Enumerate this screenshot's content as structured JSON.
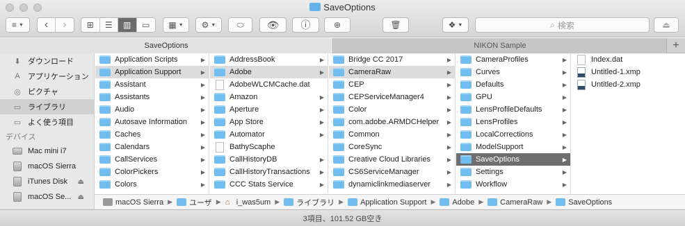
{
  "window": {
    "title": "SaveOptions"
  },
  "toolbar": {
    "search_placeholder": "検索",
    "icons": {
      "sidebar": "≡",
      "back": "‹",
      "forward": "›",
      "view_icon": "⊞",
      "view_list": "☰",
      "view_column": "▥",
      "view_cover": "▭",
      "arrange": "▦",
      "gear": "⚙",
      "tag": "⬭",
      "eye": "👁",
      "info": "ⓘ",
      "new_folder": "⊕",
      "trash": "🗑",
      "dropbox": "❖",
      "search": "⌕",
      "eject": "⏏"
    }
  },
  "tabs": [
    {
      "label": "SaveOptions",
      "active": true
    },
    {
      "label": "NIKON Sample",
      "active": false
    }
  ],
  "tab_add": "+",
  "sidebar": {
    "favorites": [
      {
        "label": "ダウンロード",
        "icon": "⬇",
        "selected": false
      },
      {
        "label": "アプリケーション",
        "icon": "A",
        "selected": false
      },
      {
        "label": "ピクチャ",
        "icon": "◎",
        "selected": false
      },
      {
        "label": "ライブラリ",
        "icon": "▭",
        "selected": true
      },
      {
        "label": "よく使う項目",
        "icon": "▭",
        "selected": false
      }
    ],
    "devices_label": "デバイス",
    "devices": [
      {
        "label": "Mac mini i7",
        "eject": ""
      },
      {
        "label": "macOS Sierra",
        "eject": ""
      },
      {
        "label": "iTunes Disk",
        "eject": "⏏"
      },
      {
        "label": "macOS Se...",
        "eject": "⏏"
      }
    ]
  },
  "columns": [
    [
      "Application Scripts",
      "Application Support",
      "Assistant",
      "Assistants",
      "Audio",
      "Autosave Information",
      "Caches",
      "Calendars",
      "CallServices",
      "ColorPickers",
      "Colors"
    ],
    [
      "AddressBook",
      "Adobe",
      "AdobeWLCMCache.dat",
      "Amazon",
      "Aperture",
      "App Store",
      "Automator",
      "BathyScaphe",
      "CallHistoryDB",
      "CallHistoryTransactions",
      "CCC Stats Service"
    ],
    [
      "Bridge CC 2017",
      "CameraRaw",
      "CEP",
      "CEPServiceManager4",
      "Color",
      "com.adobe.ARMDCHelper",
      "Common",
      "CoreSync",
      "Creative Cloud Libraries",
      "CS6ServiceManager",
      "dynamiclinkmediaserver"
    ],
    [
      "CameraProfiles",
      "Curves",
      "Defaults",
      "GPU",
      "LensProfileDefaults",
      "LensProfiles",
      "LocalCorrections",
      "ModelSupport",
      "SaveOptions",
      "Settings",
      "Workflow"
    ],
    [
      "Index.dat",
      "Untitled-1.xmp",
      "Untitled-2.xmp"
    ]
  ],
  "pathbar": [
    "macOS Sierra",
    "ユーザ",
    "i_was5um",
    "ライブラリ",
    "Application Support",
    "Adobe",
    "CameraRaw",
    "SaveOptions"
  ],
  "status": "3項目、101.52 GB空き"
}
